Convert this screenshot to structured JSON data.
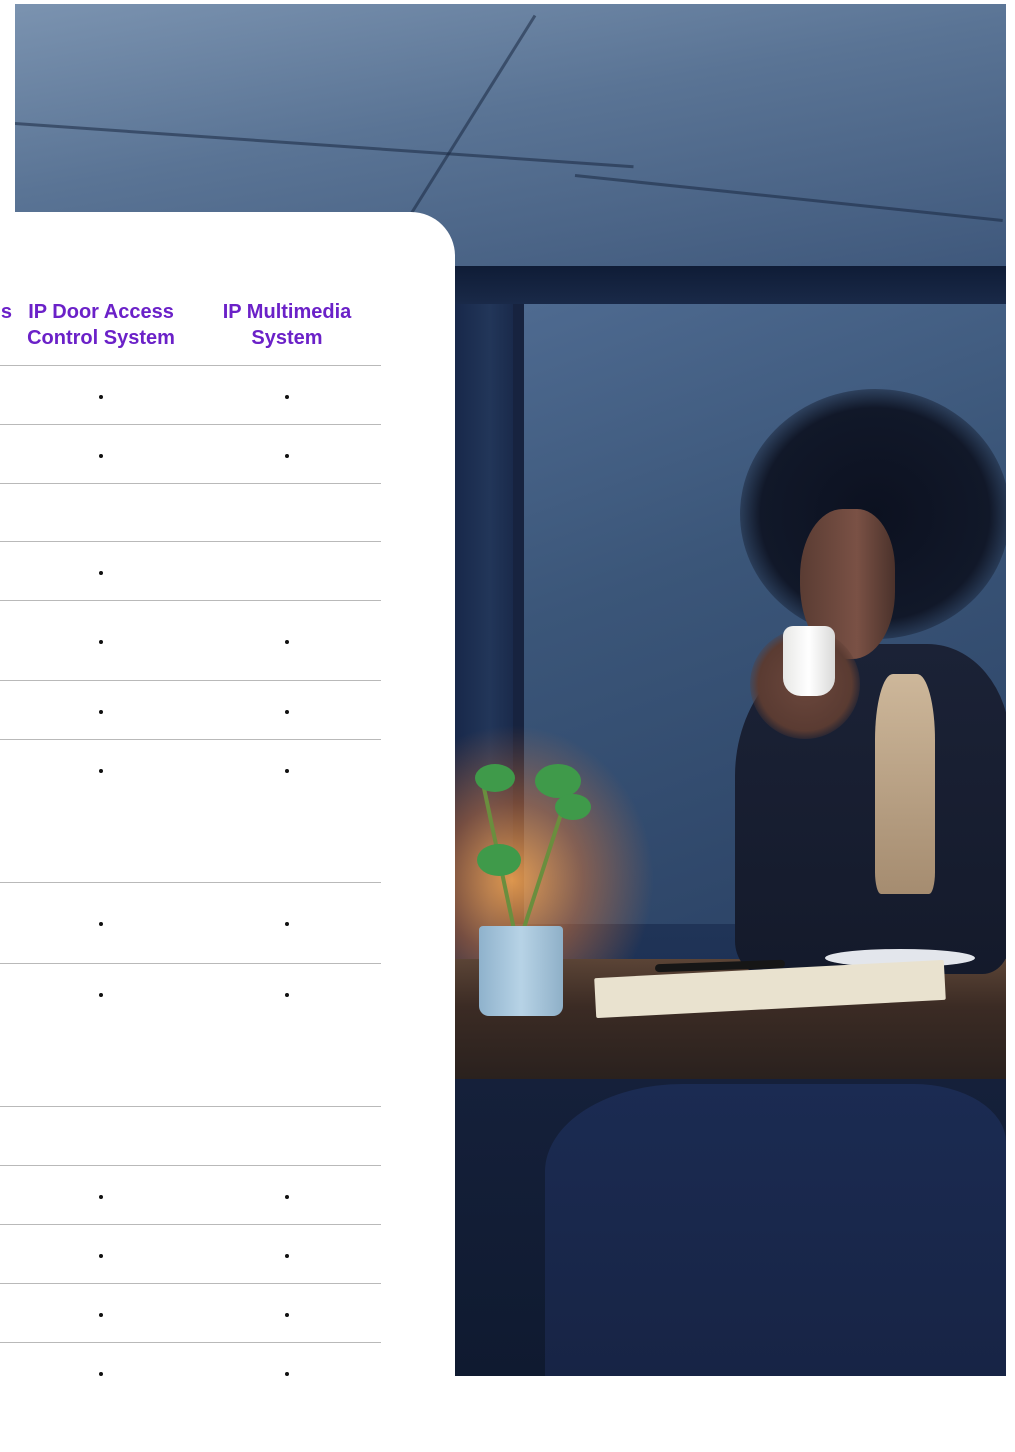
{
  "table": {
    "columns": [
      {
        "label": "s"
      },
      {
        "label": "IP Door Access Control System"
      },
      {
        "label": "IP Multimedia System"
      }
    ],
    "header_lines": {
      "partial": [
        "s"
      ],
      "door": [
        "IP Door Access",
        "Control System"
      ],
      "multimedia": [
        "IP Multimedia",
        "System"
      ]
    },
    "rows": [
      {
        "door": true,
        "multimedia": true
      },
      {
        "door": true,
        "multimedia": true
      },
      {
        "door": false,
        "multimedia": false
      },
      {
        "door": true,
        "multimedia": false
      },
      {
        "door": true,
        "multimedia": true
      },
      {
        "door": true,
        "multimedia": true
      },
      {
        "door": true,
        "multimedia": true
      },
      {
        "door": true,
        "multimedia": true
      },
      {
        "door": true,
        "multimedia": true
      },
      {
        "door": false,
        "multimedia": false
      },
      {
        "door": true,
        "multimedia": true
      },
      {
        "door": true,
        "multimedia": true
      },
      {
        "door": true,
        "multimedia": true
      },
      {
        "door": true,
        "multimedia": true
      }
    ],
    "accent_color": "#6b21c8"
  }
}
